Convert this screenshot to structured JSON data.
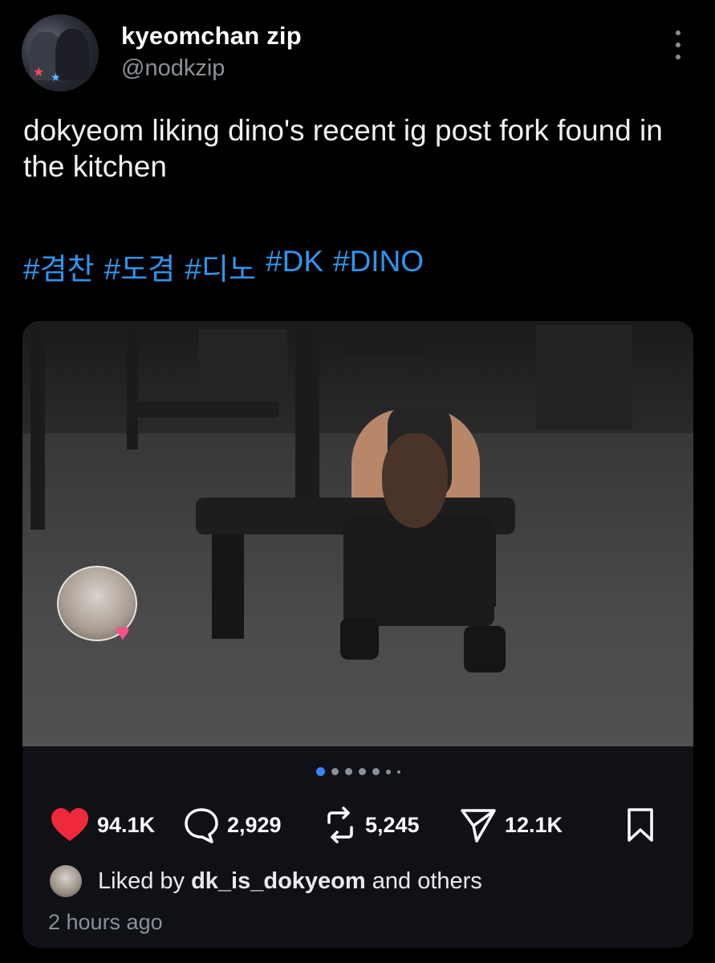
{
  "author": {
    "display_name": "kyeomchan zip",
    "handle": "@nodkzip"
  },
  "tweet": {
    "text": "dokyeom liking dino's recent ig post fork found in the kitchen",
    "hashtags": [
      "#겸찬",
      "#도겸",
      "#디노",
      "#DK",
      "#DINO"
    ]
  },
  "carousel": {
    "dot_count": 7,
    "active_index": 0
  },
  "stats": {
    "likes": "94.1K",
    "replies": "2,929",
    "reposts": "5,245",
    "shares": "12.1K"
  },
  "liked_by": {
    "prefix": "Liked by",
    "user": "dk_is_dokyeom",
    "suffix": "and others"
  },
  "timestamp": "2 hours ago",
  "colors": {
    "background": "#000000",
    "card_background": "#0f1117",
    "hashtag": "#2f96ef",
    "like": "#f0283c",
    "secondary_text": "#8b9097"
  },
  "icons": {
    "like": "heart-icon",
    "reply": "comment-icon",
    "repost": "repost-icon",
    "share": "share-icon",
    "bookmark": "bookmark-icon",
    "more": "more-vertical-icon"
  }
}
